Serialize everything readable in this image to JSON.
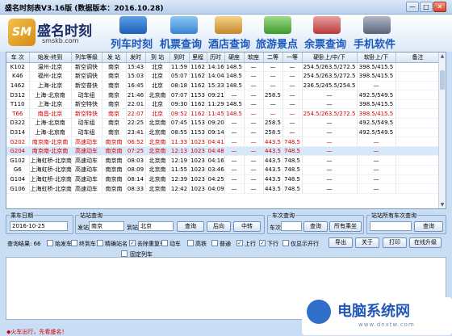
{
  "window": {
    "title": "盛名时刻表V3.16版 (数据版本：2016.10.28)",
    "min": "—",
    "max": "□",
    "close": "✕"
  },
  "brand": {
    "mark": "SM",
    "name": "盛名时刻",
    "site": "smskb.com"
  },
  "nav": [
    {
      "label": "列车时刻",
      "icon": "train-icon"
    },
    {
      "label": "机票查询",
      "icon": "plane-icon"
    },
    {
      "label": "酒店查询",
      "icon": "hotel-icon"
    },
    {
      "label": "旅游景点",
      "icon": "palm-tree-icon"
    },
    {
      "label": "余票查询",
      "icon": "ticket-icon"
    },
    {
      "label": "手机软件",
      "icon": "phone-icon"
    }
  ],
  "table": {
    "columns": [
      "车 次",
      "始发-终到",
      "列车等级",
      "发 站",
      "发时",
      "到 站",
      "到时",
      "里程",
      "历时",
      "硬座",
      "软座",
      "二等",
      "一等",
      "硬卧上/中/下",
      "软卧上/下",
      "备注"
    ],
    "rows": [
      {
        "c": [
          "K102",
          "温州-北京",
          "新空调快",
          "南京",
          "15:43",
          "北京",
          "11:59",
          "1162",
          "14:16",
          "148.5",
          "—",
          "—",
          "—",
          "254.5/263.5/272.5",
          "398.5/415.5",
          ""
        ],
        "style": ""
      },
      {
        "c": [
          "K46",
          "福州-北京",
          "新空调快",
          "南京",
          "15:03",
          "北京",
          "05:07",
          "1162",
          "14:04",
          "148.5",
          "—",
          "—",
          "—",
          "254.5/263.5/272.5",
          "398.5/415.5",
          ""
        ],
        "style": ""
      },
      {
        "c": [
          "1462",
          "上海-北京",
          "新空普快",
          "南京",
          "16:45",
          "北京",
          "08:18",
          "1162",
          "15:33",
          "148.5",
          "—",
          "—",
          "—",
          "236.5/245.5/254.5",
          "—",
          ""
        ],
        "style": ""
      },
      {
        "c": [
          "D312",
          "上海-北京南",
          "动车组",
          "南京",
          "21:46",
          "北京南",
          "07:07",
          "1153",
          "09:21",
          "—",
          "—",
          "258.5",
          "—",
          "—",
          "492.5/549.5",
          ""
        ],
        "style": ""
      },
      {
        "c": [
          "T110",
          "上海-北京",
          "新空特快",
          "南京",
          "22:01",
          "北京",
          "09:30",
          "1162",
          "11:29",
          "148.5",
          "—",
          "—",
          "—",
          "—",
          "398.5/415.5",
          ""
        ],
        "style": ""
      },
      {
        "c": [
          "T66",
          "南昌-北京",
          "新空特快",
          "南京",
          "22:07",
          "北京",
          "09:52",
          "1162",
          "11:45",
          "148.5",
          "—",
          "—",
          "—",
          "254.5/263.5/272.5",
          "398.5/415.5",
          ""
        ],
        "style": "red"
      },
      {
        "c": [
          "D322",
          "上海-北京南",
          "动车组",
          "南京",
          "22:25",
          "北京南",
          "07:45",
          "1153",
          "09:20",
          "—",
          "—",
          "258.5",
          "—",
          "—",
          "492.5/549.5",
          ""
        ],
        "style": ""
      },
      {
        "c": [
          "D314",
          "上海-北京南",
          "动车组",
          "南京",
          "23:41",
          "北京南",
          "08:55",
          "1153",
          "09:14",
          "—",
          "—",
          "258.5",
          "—",
          "—",
          "492.5/549.5",
          ""
        ],
        "style": ""
      },
      {
        "c": [
          "G202",
          "南京南-北京南",
          "高速动车",
          "南京南",
          "06:52",
          "北京南",
          "11:33",
          "1023",
          "04:41",
          "—",
          "—",
          "443.5",
          "748.5",
          "—",
          "—",
          ""
        ],
        "style": "red"
      },
      {
        "c": [
          "G204",
          "南京南-北京南",
          "高速动车",
          "南京南",
          "07:25",
          "北京南",
          "12:13",
          "1023",
          "04:48",
          "—",
          "—",
          "443.5",
          "748.5",
          "—",
          "—",
          ""
        ],
        "style": "red sel"
      },
      {
        "c": [
          "G102",
          "上海虹桥-北京南",
          "高速动车",
          "南京南",
          "08:03",
          "北京南",
          "12:19",
          "1023",
          "04:16",
          "—",
          "—",
          "443.5",
          "748.5",
          "—",
          "—",
          ""
        ],
        "style": ""
      },
      {
        "c": [
          "G6",
          "上海虹桥-北京南",
          "高速动车",
          "南京南",
          "08:09",
          "北京南",
          "11:55",
          "1023",
          "03:46",
          "—",
          "—",
          "443.5",
          "748.5",
          "—",
          "—",
          ""
        ],
        "style": ""
      },
      {
        "c": [
          "G104",
          "上海虹桥-北京南",
          "高速动车",
          "南京南",
          "08:14",
          "北京南",
          "12:39",
          "1023",
          "04:25",
          "—",
          "—",
          "443.5",
          "748.5",
          "—",
          "—",
          ""
        ],
        "style": ""
      },
      {
        "c": [
          "G106",
          "上海虹桥-北京南",
          "高速动车",
          "南京南",
          "08:33",
          "北京南",
          "12:42",
          "1023",
          "04:09",
          "—",
          "—",
          "443.5",
          "748.5",
          "—",
          "—",
          ""
        ],
        "style": ""
      }
    ]
  },
  "date_group": {
    "title": "乘车日期",
    "value": "2016-10-25"
  },
  "station_group": {
    "title": "站站查询",
    "from_label": "发站",
    "from_value": "南京",
    "to_label": "到站",
    "to_value": "北京",
    "query": "查询",
    "prev": "后向",
    "transfer": "中转"
  },
  "train_group": {
    "title": "车次查询",
    "no_label": "车次",
    "query": "查询",
    "all": "所有乘坐"
  },
  "stationall_group": {
    "title": "站站所有车次查询",
    "query": "查询"
  },
  "filters": {
    "result_label": "查询结果: 66",
    "items": [
      {
        "label": "始发车",
        "on": false
      },
      {
        "label": "终到车",
        "on": false
      },
      {
        "label": "精确站名",
        "on": false
      },
      {
        "label": "去除重复车",
        "on": true
      },
      {
        "label": "动车",
        "on": false
      },
      {
        "label": "高铁",
        "on": false
      },
      {
        "label": "普通",
        "on": false
      },
      {
        "label": "上行",
        "on": true
      },
      {
        "label": "下行",
        "on": true
      },
      {
        "label": "仅显示开行",
        "on": false
      }
    ],
    "fixed": {
      "label": "固定列车",
      "on": false
    }
  },
  "actions": {
    "export": "导出",
    "about": "关于",
    "print": "打印",
    "upgrade": "在线升级"
  },
  "status": "◆火车出行，先看盛名！",
  "watermark": {
    "title": "电脑系统网",
    "url": "www.dnxtw.com"
  }
}
